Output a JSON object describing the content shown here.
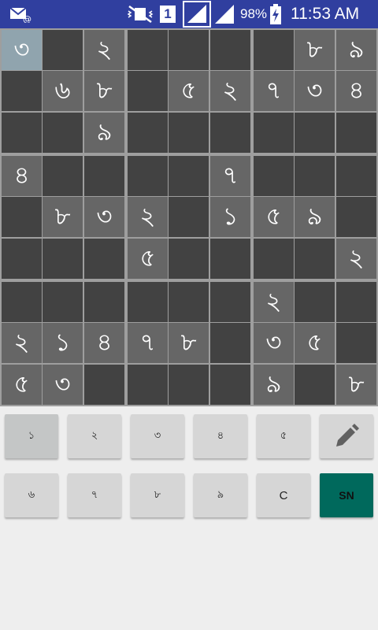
{
  "status_bar": {
    "icons": [
      "mail-at-icon",
      "mute-vibrate-icon",
      "sim-1-icon",
      "signal-sim1-icon",
      "signal-sim2-icon",
      "battery-charging-icon"
    ],
    "sim_label": "1",
    "battery": "98%",
    "time": "11:53 AM"
  },
  "board": {
    "rows": [
      [
        "৩",
        "",
        "২",
        "",
        "",
        "",
        "",
        "৮",
        "৯"
      ],
      [
        "",
        "৬",
        "৮",
        "",
        "৫",
        "২",
        "৭",
        "৩",
        "৪"
      ],
      [
        "",
        "",
        "৯",
        "",
        "",
        "",
        "",
        "",
        ""
      ],
      [
        "৪",
        "",
        "",
        "",
        "",
        "৭",
        "",
        "",
        ""
      ],
      [
        "",
        "৮",
        "৩",
        "২",
        "",
        "১",
        "৫",
        "৯",
        ""
      ],
      [
        "",
        "",
        "",
        "৫",
        "",
        "",
        "",
        "",
        "২"
      ],
      [
        "",
        "",
        "",
        "",
        "",
        "",
        "২",
        "",
        ""
      ],
      [
        "২",
        "১",
        "৪",
        "৭",
        "৮",
        "",
        "৩",
        "৫",
        ""
      ],
      [
        "৫",
        "৩",
        "",
        "",
        "",
        "",
        "৯",
        "",
        "৮"
      ]
    ],
    "selected_row": 0,
    "selected_col": 0
  },
  "keypad": {
    "row1": [
      "১",
      "২",
      "৩",
      "৪",
      "৫"
    ],
    "row2": [
      "৬",
      "৭",
      "৮",
      "৯",
      "C",
      "SN"
    ],
    "pencil_icon": "pencil-icon",
    "colors": {
      "key": "#d6d6d6",
      "sn_key": "#00695c",
      "status_bar": "#303f9f",
      "cell_empty": "#424242",
      "cell_given": "#666666",
      "cell_selected": "#90a4ae"
    }
  }
}
